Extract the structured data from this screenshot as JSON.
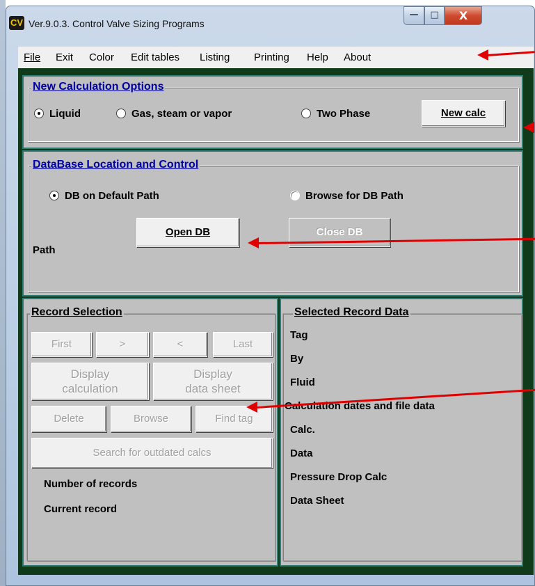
{
  "window": {
    "icon_text": "CV",
    "title": "Ver.9.0.3.  Control Valve Sizing Programs",
    "minimize_glyph": "—",
    "maximize_glyph": "□",
    "close_glyph": "X"
  },
  "menu": {
    "items": [
      {
        "label": "File",
        "accel": "F"
      },
      {
        "label": "Exit",
        "accel": "x"
      },
      {
        "label": "Color",
        "accel": "C"
      },
      {
        "label": "Edit tables",
        "accel": "E"
      },
      {
        "label": "Listing",
        "accel": "L"
      },
      {
        "label": "Printing",
        "accel": ""
      },
      {
        "label": "Help",
        "accel": "H"
      },
      {
        "label": "About",
        "accel": "A"
      }
    ]
  },
  "new_calc": {
    "title": "New Calculation Options",
    "options": [
      {
        "label": "Liquid",
        "selected": true
      },
      {
        "label": "Gas, steam or vapor",
        "selected": false
      },
      {
        "label": "Two Phase",
        "selected": false
      }
    ],
    "new_calc_button": "New calc"
  },
  "database": {
    "title": "DataBase Location and Control",
    "default_path_radio": "DB on Default Path",
    "default_path_selected": true,
    "browse_radio": "Browse for DB Path",
    "browse_selected": false,
    "open_button": "Open DB",
    "close_button": "Close DB",
    "path_label": "Path"
  },
  "record_selection": {
    "title": "Record Selection",
    "first": "First",
    "next": ">",
    "prev": "<",
    "last": "Last",
    "display_calc_line1": "Display",
    "display_calc_line2": "calculation",
    "display_sheet_line1": "Display",
    "display_sheet_line2": "data sheet",
    "delete": "Delete",
    "browse": "Browse",
    "find_tag": "Find tag",
    "search_outdated": "Search for outdated calcs",
    "number_of_records": "Number of records",
    "current_record": "Current record"
  },
  "selected_record": {
    "title": "Selected Record Data",
    "tag": "Tag",
    "by": "By",
    "fluid": "Fluid",
    "dates_heading": "Calculation dates and file data",
    "calc": "Calc.",
    "data": "Data",
    "pressure_drop_calc": "Pressure Drop Calc",
    "data_sheet": "Data Sheet"
  },
  "colors": {
    "client_background": "#0f3b1a",
    "panel_gray": "#c0c0c0",
    "section_border": "#2f7a72",
    "group_title_blue": "#0000a8",
    "annotation_red": "#e00000"
  }
}
